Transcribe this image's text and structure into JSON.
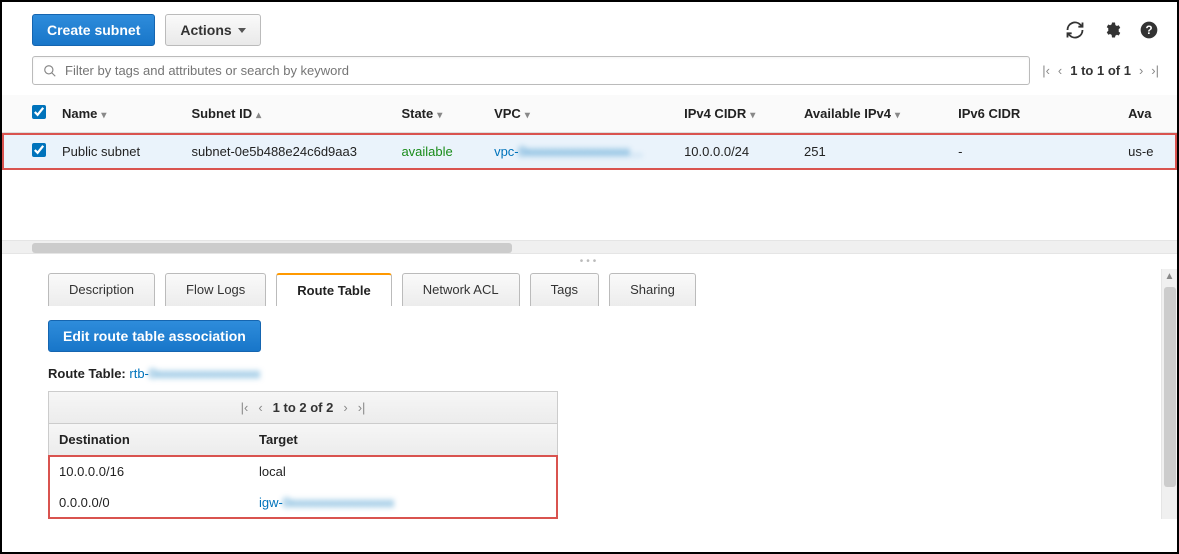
{
  "toolbar": {
    "create_label": "Create subnet",
    "actions_label": "Actions"
  },
  "filter": {
    "placeholder": "Filter by tags and attributes or search by keyword"
  },
  "pager_top": {
    "text": "1 to 1 of 1"
  },
  "columns": {
    "name": "Name",
    "subnet_id": "Subnet ID",
    "state": "State",
    "vpc": "VPC",
    "ipv4_cidr": "IPv4 CIDR",
    "avail_ipv4": "Available IPv4",
    "ipv6_cidr": "IPv6 CIDR",
    "avail_zone": "Ava"
  },
  "rows": [
    {
      "name": "Public subnet",
      "subnet_id": "subnet-0e5b488e24c6d9aa3",
      "state": "available",
      "vpc_prefix": "vpc-",
      "vpc_rest": "0xxxxxxxxxxxxxxxx…",
      "ipv4_cidr": "10.0.0.0/24",
      "avail_ipv4": "251",
      "ipv6_cidr": "-",
      "avail_zone": "us-e"
    }
  ],
  "tabs": {
    "description": "Description",
    "flow_logs": "Flow Logs",
    "route_table": "Route Table",
    "network_acl": "Network ACL",
    "tags": "Tags",
    "sharing": "Sharing"
  },
  "route_panel": {
    "edit_button": "Edit route table association",
    "label": "Route Table:",
    "rtb_prefix": "rtb-",
    "rtb_rest": "0xxxxxxxxxxxxxxxx",
    "pager": "1 to 2 of 2",
    "cols": {
      "destination": "Destination",
      "target": "Target"
    },
    "routes": [
      {
        "destination": "10.0.0.0/16",
        "target": "local",
        "is_link": false
      },
      {
        "destination": "0.0.0.0/0",
        "target_prefix": "igw-",
        "target_rest": "0xxxxxxxxxxxxxxxx",
        "is_link": true
      }
    ]
  }
}
